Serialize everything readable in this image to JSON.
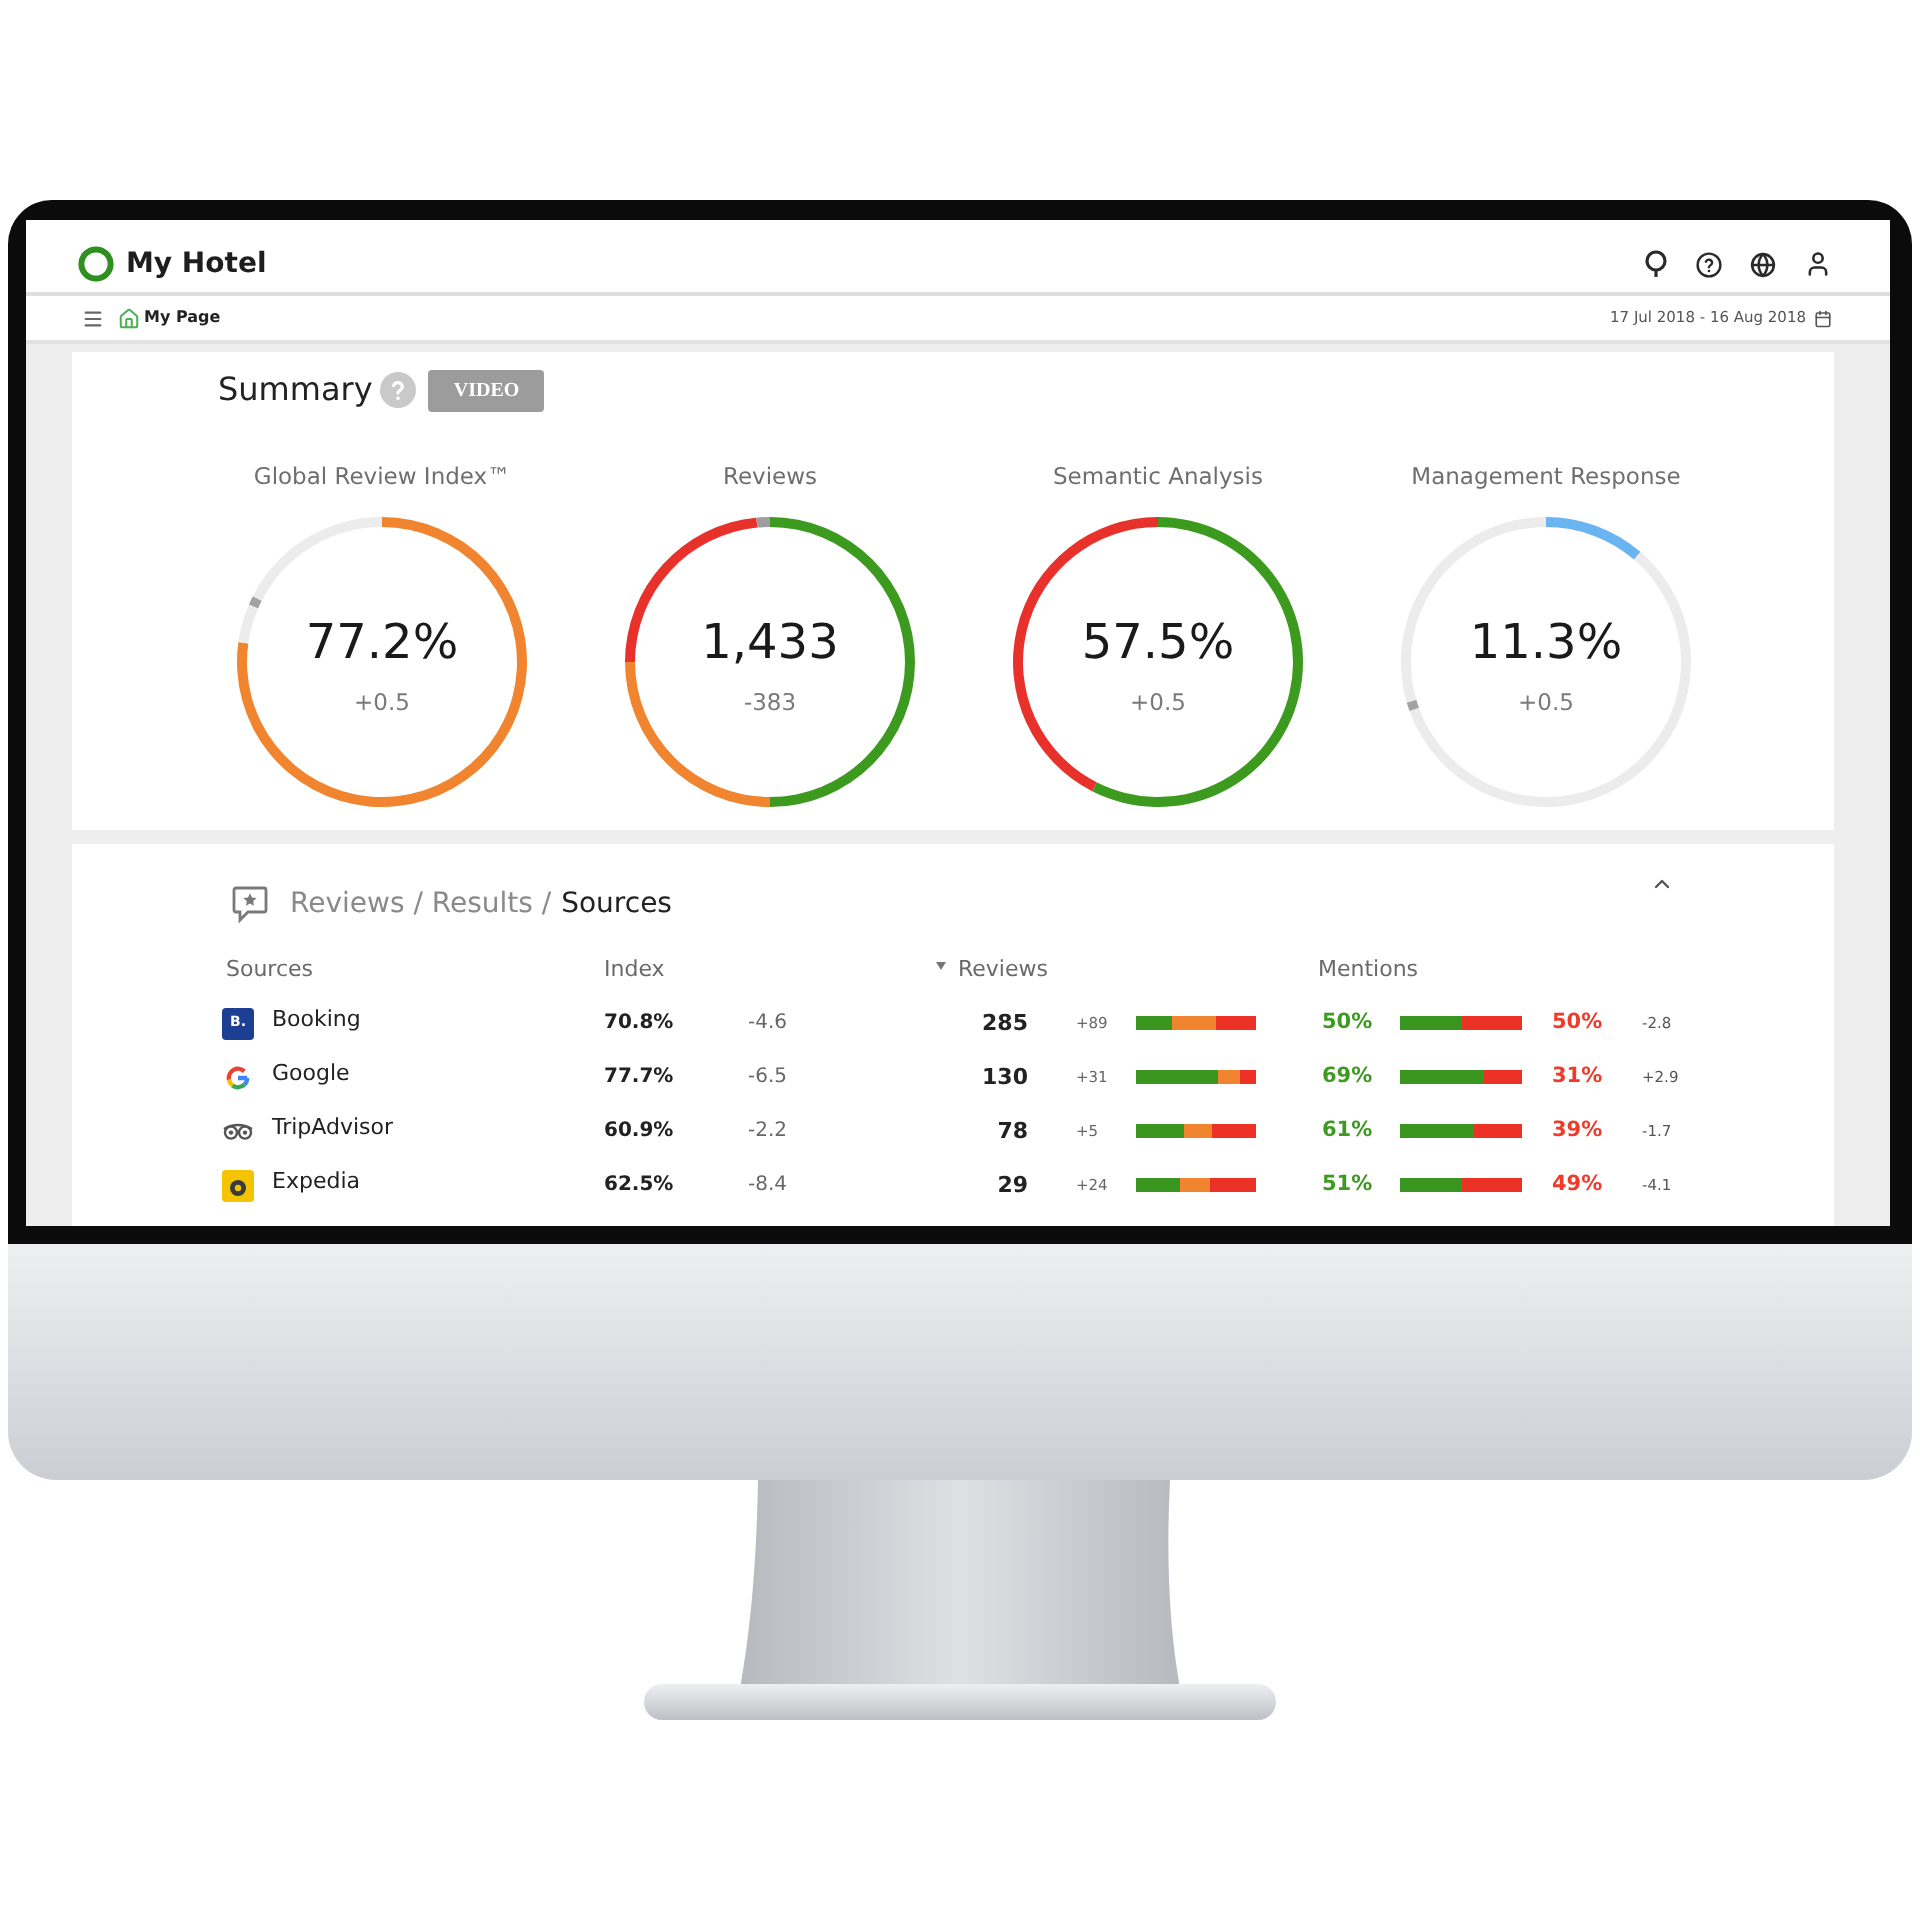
{
  "top_bar": {
    "title": "My Hotel"
  },
  "sub_bar": {
    "page": "My Page",
    "date_range": "17 Jul 2018 - 16 Aug 2018"
  },
  "summary": {
    "title": "Summary",
    "video_button": "VIDEO",
    "gauges": [
      {
        "title": "Global Review Index™",
        "value": "77.2%",
        "change": "+0.5",
        "slices": [
          {
            "color": "#f0842f"
          },
          {
            "color": "#ececec"
          },
          {
            "color": "#a3a3a3"
          },
          {
            "color": "#ececec"
          }
        ],
        "chart_data": {
          "type": "donut",
          "values": [
            77.2,
            4.3,
            1,
            17.5
          ]
        }
      },
      {
        "title": "Reviews",
        "value": "1,433",
        "change": "-383",
        "slices": [
          {
            "color": "#3c9a1f"
          },
          {
            "color": "#f0842f"
          },
          {
            "color": "#e8312b"
          },
          {
            "color": "#9e9e9e"
          }
        ],
        "chart_data": {
          "type": "donut",
          "values": [
            50,
            25,
            23.5,
            1.5
          ]
        }
      },
      {
        "title": "Semantic Analysis",
        "value": "57.5%",
        "change": "+0.5",
        "slices": [
          {
            "color": "#3c9a1f"
          },
          {
            "color": "#e8312b"
          }
        ],
        "chart_data": {
          "type": "donut",
          "values": [
            57.5,
            42.5
          ]
        }
      },
      {
        "title": "Management Response",
        "value": "11.3%",
        "change": "+0.5",
        "slices": [
          {
            "color": "#6ab4f2"
          },
          {
            "color": "#ececec"
          },
          {
            "color": "#a3a3a3"
          },
          {
            "color": "#ececec"
          }
        ],
        "chart_data": {
          "type": "donut",
          "values": [
            11.3,
            58.2,
            1,
            29.5
          ]
        }
      }
    ]
  },
  "sources": {
    "path": "Reviews / Results /",
    "current": "Sources",
    "expanded": true,
    "columns": [
      {
        "label": "Sources",
        "sorted": false
      },
      {
        "label": "Index",
        "sorted": false
      },
      {
        "label": "Reviews",
        "sorted": true
      },
      {
        "label": "Mentions",
        "sorted": false
      }
    ],
    "rows": [
      {
        "name": "Booking",
        "logo": {
          "kind": "letter",
          "text": "B."
        },
        "index": "70.8%",
        "index_change": "-4.6",
        "reviews": "285",
        "reviews_change": "+89",
        "review_bar": {
          "positive": {
            "level": 0.3
          },
          "negative": {
            "level": 0.33
          }
        },
        "positive": "50%",
        "mention_bar": {
          "level": 0.5
        },
        "negative": "50%",
        "mentions_change": "-2.8"
      },
      {
        "name": "Google",
        "logo": {
          "kind": "g"
        },
        "index": "77.7%",
        "index_change": "-6.5",
        "reviews": "130",
        "reviews_change": "+31",
        "review_bar": {
          "positive": {
            "level": 0.69
          },
          "negative": {
            "level": 0.14
          }
        },
        "positive": "69%",
        "mention_bar": {
          "level": 0.69
        },
        "negative": "31%",
        "mentions_change": "+2.9"
      },
      {
        "name": "TripAdvisor",
        "logo": {
          "kind": "owl"
        },
        "index": "60.9%",
        "index_change": "-2.2",
        "reviews": "78",
        "reviews_change": "+5",
        "review_bar": {
          "positive": {
            "level": 0.4
          },
          "negative": {
            "level": 0.37
          }
        },
        "positive": "61%",
        "mention_bar": {
          "level": 0.61
        },
        "negative": "39%",
        "mentions_change": "-1.7"
      },
      {
        "name": "Expedia",
        "logo": {
          "kind": "tile"
        },
        "index": "62.5%",
        "index_change": "-8.4",
        "reviews": "29",
        "reviews_change": "+24",
        "review_bar": {
          "positive": {
            "level": 0.36
          },
          "negative": {
            "level": 0.38
          }
        },
        "positive": "51%",
        "mention_bar": {
          "level": 0.51
        },
        "negative": "49%",
        "mentions_change": "-4.1"
      }
    ]
  }
}
